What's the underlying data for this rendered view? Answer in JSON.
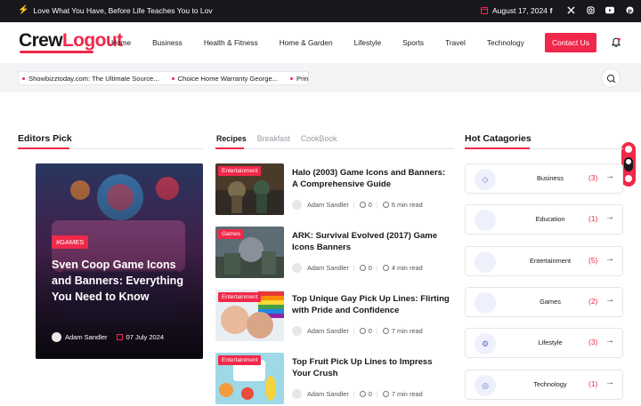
{
  "topbar": {
    "tagline": "Love What You Have, Before Life Teaches You to Lov",
    "date": "August 17, 2024",
    "social_icons": [
      "facebook-icon",
      "twitter-icon",
      "instagram-icon",
      "youtube-icon",
      "pinterest-icon"
    ]
  },
  "header": {
    "logo_part1": "Crew",
    "logo_part2": "Logout",
    "nav": [
      "Home",
      "Business",
      "Health & Fitness",
      "Home & Garden",
      "Lifestyle",
      "Sports",
      "Travel",
      "Technology"
    ],
    "contact_label": "Contact Us"
  },
  "ticker": {
    "items": [
      "Showbizztoday.com: The Ultimate Source...",
      "Choice Home Warranty George...",
      "Prince Narula"
    ]
  },
  "editors_pick": {
    "heading": "Editors Pick",
    "hero": {
      "badge": "#GAMES",
      "title": "Sven Coop Game Icons and Banners: Everything You Need to Know",
      "author": "Adam Sandler",
      "date": "07 July 2024"
    }
  },
  "tabs": [
    "Recipes",
    "Breakfast",
    "CookBook"
  ],
  "posts": [
    {
      "category": "Entertainment",
      "title": "Halo (2003) Game Icons and Banners: A Comprehensive Guide",
      "author": "Adam Sandler",
      "comments": "0",
      "read": "6 min read"
    },
    {
      "category": "Games",
      "title": "ARK: Survival Evolved (2017) Game Icons Banners",
      "author": "Adam Sandler",
      "comments": "0",
      "read": "4 min read"
    },
    {
      "category": "Entertainment",
      "title": "Top Unique Gay Pick Up Lines: Flirting with Pride and Confidence",
      "author": "Adam Sandler",
      "comments": "0",
      "read": "7 min read"
    },
    {
      "category": "Entertainment",
      "title": "Top Fruit Pick Up Lines to Impress Your Crush",
      "author": "Adam Sandler",
      "comments": "0",
      "read": "7 min read"
    }
  ],
  "hot_categories": {
    "heading": "Hot Catagories",
    "items": [
      {
        "name": "Business",
        "count": "(3)",
        "icon": "diamond-icon"
      },
      {
        "name": "Education",
        "count": "(1)",
        "icon": ""
      },
      {
        "name": "Entertainment",
        "count": "(5)",
        "icon": ""
      },
      {
        "name": "Games",
        "count": "(2)",
        "icon": ""
      },
      {
        "name": "Lifestyle",
        "count": "(3)",
        "icon": "lifestyle-icon"
      },
      {
        "name": "Technology",
        "count": "(1)",
        "icon": "globe-icon"
      }
    ]
  },
  "colors": {
    "accent": "#f0284a",
    "dark": "#17171c"
  }
}
